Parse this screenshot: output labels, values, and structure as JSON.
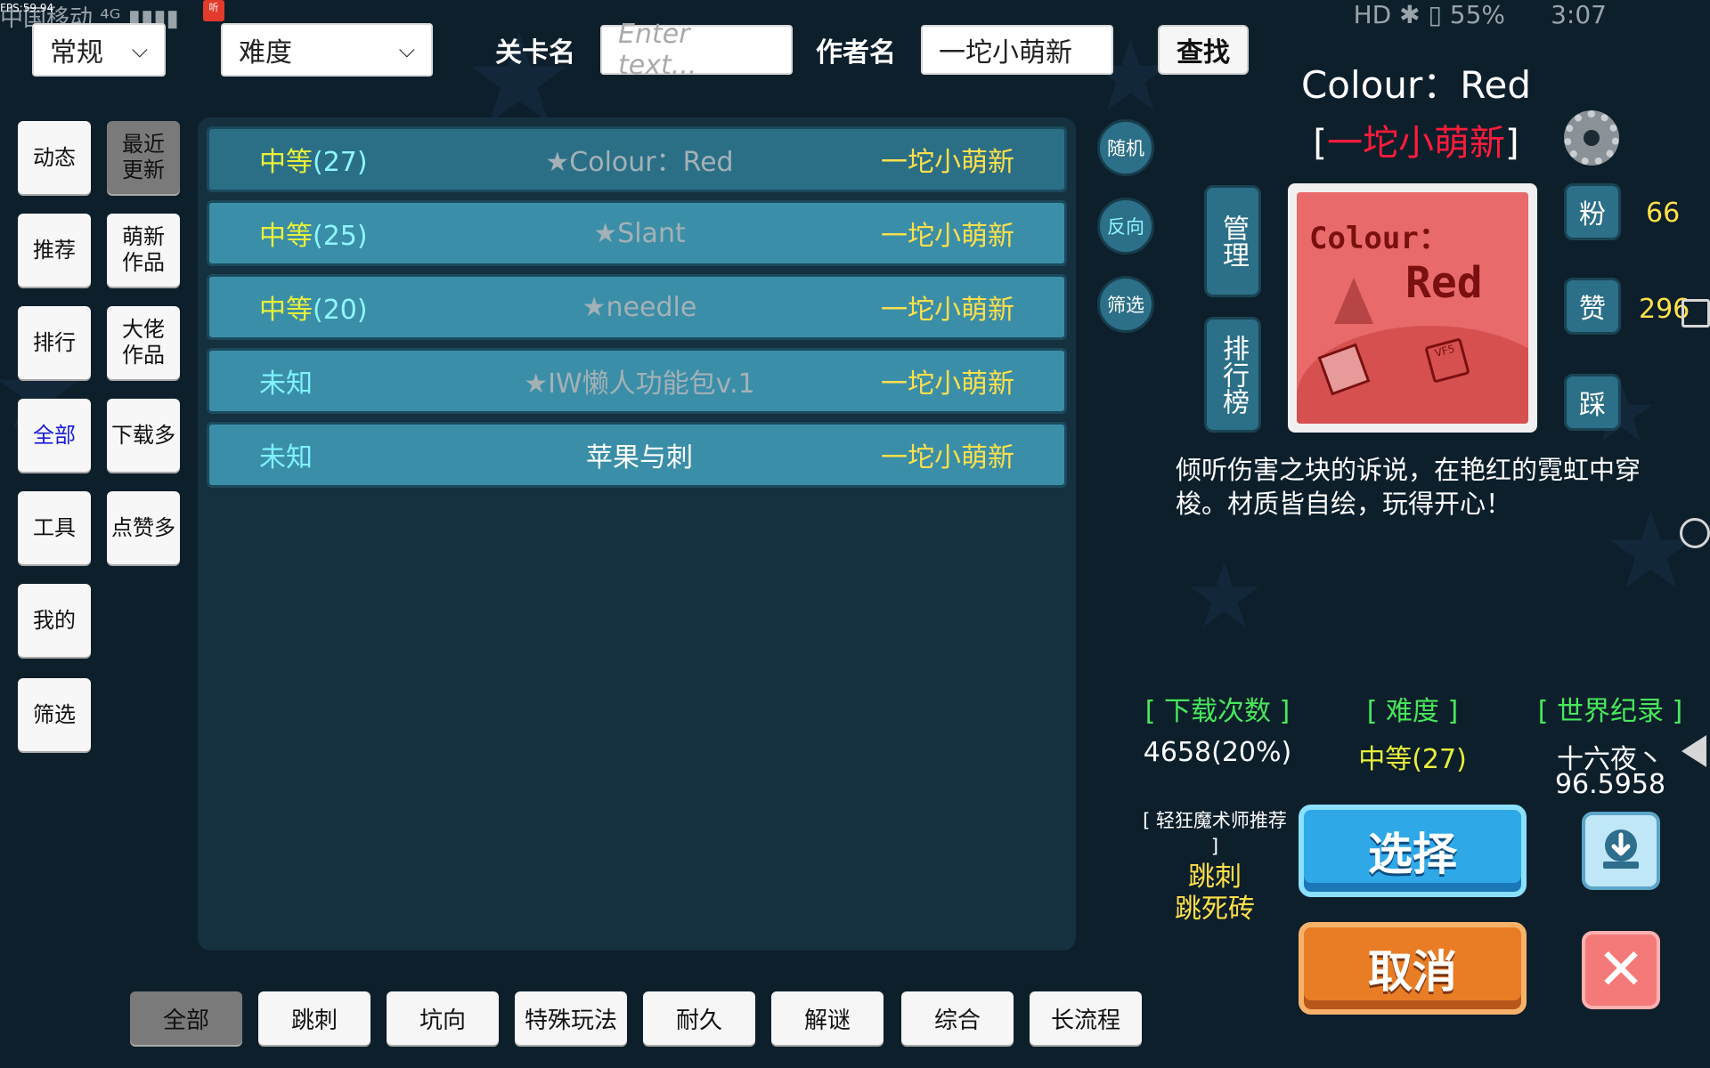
{
  "status_bar": {
    "fps": "FPS:59.94",
    "carrier": "中国移动 ⁴ᴳ ▮▮▮▮",
    "app_badge": "听",
    "indicators": "HD ✱ ▯ 55%",
    "time": "3:07"
  },
  "top_bar": {
    "mode_select": "常规",
    "difficulty_select": "难度",
    "level_name_label": "关卡名",
    "level_name_placeholder": "Enter text...",
    "author_label": "作者名",
    "author_value": "一坨小萌新",
    "search_button": "查找"
  },
  "left_nav": {
    "col1": [
      "动态",
      "推荐",
      "排行",
      "全部",
      "工具",
      "我的",
      "筛选"
    ],
    "col2": [
      "最近更新",
      "萌新作品",
      "大佬作品",
      "下载多",
      "点赞多"
    ]
  },
  "list": [
    {
      "difficulty": "中等",
      "level": "(27)",
      "name": "★Colour：Red",
      "author": "一坨小萌新"
    },
    {
      "difficulty": "中等",
      "level": "(25)",
      "name": "★Slant",
      "author": "一坨小萌新"
    },
    {
      "difficulty": "中等",
      "level": "(20)",
      "name": "★needle",
      "author": "一坨小萌新"
    },
    {
      "difficulty": "未知",
      "level": "",
      "name": "★IW懒人功能包v.1",
      "author": "一坨小萌新"
    },
    {
      "difficulty": "未知",
      "level": "",
      "name": "苹果与刺",
      "author": "一坨小萌新"
    }
  ],
  "round_buttons": {
    "random": "随机",
    "reverse": "反向",
    "filter": "筛选"
  },
  "detail": {
    "title": "Colour：Red",
    "author_open": "[",
    "author": "一坨小萌新",
    "author_close": "]",
    "manage": "管理",
    "ranking": "排行榜",
    "cover_text_1": "Colour：",
    "cover_text_2": "Red",
    "cover_stamp": "VF5",
    "fans_label": "粉",
    "fans_value": "66",
    "likes_label": "赞",
    "likes_value": "296",
    "dislike_label": "踩",
    "description": "倾听伤害之块的诉说，在艳红的霓虹中穿梭。材质皆自绘，玩得开心！",
    "downloads_head": "[ 下载次数 ]",
    "downloads_value": "4658(20%)",
    "difficulty_head": "[ 难度 ]",
    "difficulty_value": "中等(27)",
    "record_head": "[ 世界纪录 ]",
    "record_holder": "十六夜丶",
    "record_time": "96.5958",
    "recommend_title": "[ 轻狂魔术师推荐 ]",
    "recommend_tags": [
      "跳刺",
      "跳死砖"
    ],
    "select_button": "选择",
    "cancel_button": "取消"
  },
  "bottom_tags": [
    "全部",
    "跳刺",
    "坑向",
    "特殊玩法",
    "耐久",
    "解谜",
    "综合",
    "长流程"
  ],
  "colors": {
    "background": "#0d1f2b",
    "row": "#3b8ea8",
    "difficulty_text": "#e8f03a",
    "author_text": "#ffe04a",
    "author_highlight": "#ff1b3b",
    "info_head": "#47e85b"
  },
  "icons": [
    "gear-icon",
    "download-icon",
    "close-icon",
    "chevron-down-icon"
  ]
}
